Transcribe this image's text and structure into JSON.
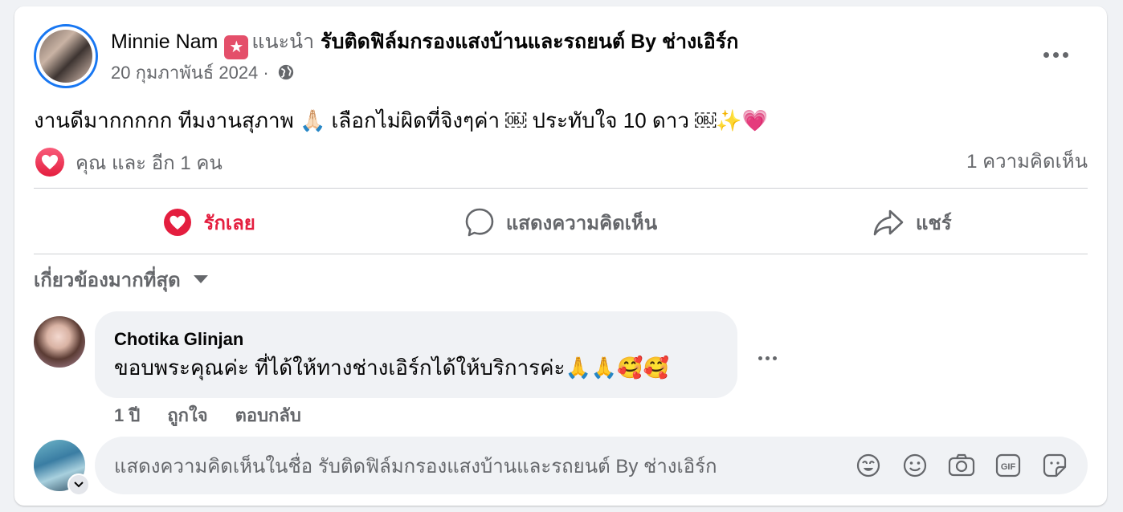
{
  "post": {
    "author": "Minnie Nam",
    "recommends": "แนะนำ",
    "page_name": "รับติดฟิล์มกรองแสงบ้านและรถยนต์ By ช่างเอิร์ก",
    "date": "20 กุมภาพันธ์ 2024",
    "separator": "·",
    "body": "งานดีมากกกกก ทีมงานสุภาพ 🙏🏻 เลือกไม่ผิดที่จิงๆค่า ￼ ประทับใจ 10 ดาว ￼✨💗"
  },
  "reactions": {
    "summary": "คุณ และ อีก 1 คน",
    "comment_count": "1 ความคิดเห็น"
  },
  "actions": {
    "like": "รักเลย",
    "comment": "แสดงความคิดเห็น",
    "share": "แชร์"
  },
  "sort": {
    "label": "เกี่ยวข้องมากที่สุด"
  },
  "comment": {
    "author": "Chotika Glinjan",
    "text": "ขอบพระคุณค่ะ ที่ได้ให้ทางช่างเอิร์กได้ให้บริการค่ะ🙏🙏🥰🥰",
    "age": "1 ปี",
    "like": "ถูกใจ",
    "reply": "ตอบกลับ"
  },
  "composer": {
    "placeholder": "แสดงความคิดเห็นในชื่อ รับติดฟิล์มกรองแสงบ้านและรถยนต์ By ช่างเอิร์ก",
    "icons": [
      "avatar-sticker-icon",
      "emoji-icon",
      "camera-icon",
      "gif-icon",
      "sticker-icon"
    ]
  },
  "colors": {
    "accent_blue": "#1877f2",
    "love_red": "#e41e3f",
    "secondary_text": "#65676b",
    "bubble_bg": "#f0f2f5"
  }
}
